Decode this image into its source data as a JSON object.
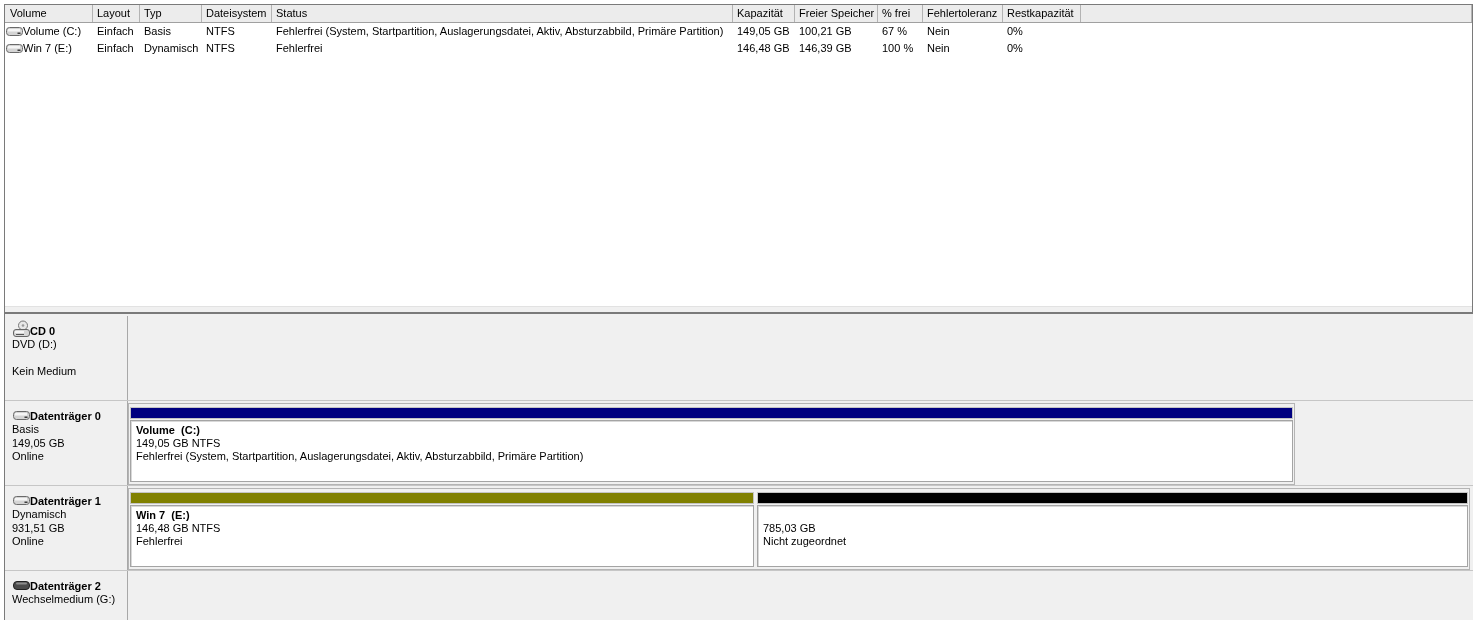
{
  "volume_table": {
    "columns": [
      "Volume",
      "Layout",
      "Typ",
      "Dateisystem",
      "Status",
      "Kapazität",
      "Freier Speicher",
      "% frei",
      "Fehlertoleranz",
      "Restkapazität"
    ],
    "rows": [
      [
        "Volume (C:)",
        "Einfach",
        "Basis",
        "NTFS",
        "Fehlerfrei (System, Startpartition, Auslagerungsdatei, Aktiv, Absturzabbild, Primäre Partition)",
        "149,05 GB",
        "100,21 GB",
        "67 %",
        "Nein",
        "0%"
      ],
      [
        "Win 7 (E:)",
        "Einfach",
        "Dynamisch",
        "NTFS",
        "Fehlerfrei",
        "146,48 GB",
        "146,39 GB",
        "100 %",
        "Nein",
        "0%"
      ]
    ]
  },
  "disks": [
    {
      "kind": "cd",
      "name": "CD 0",
      "type": "DVD (D:)",
      "status": "Kein Medium"
    },
    {
      "kind": "disk",
      "name": "Datenträger 0",
      "type": "Basis",
      "size": "149,05 GB",
      "status": "Online",
      "partitions": [
        {
          "kind": "volume",
          "color": "#000080",
          "title": "Volume  (C:)",
          "size": "149,05 GB NTFS",
          "status": "Fehlerfrei (System, Startpartition, Auslagerungsdatei, Aktiv, Absturzabbild, Primäre Partition)"
        }
      ]
    },
    {
      "kind": "disk",
      "name": "Datenträger 1",
      "type": "Dynamisch",
      "size": "931,51 GB",
      "status": "Online",
      "partitions": [
        {
          "kind": "volume",
          "color": "#808000",
          "title": "Win 7  (E:)",
          "size": "146,48 GB NTFS",
          "status": "Fehlerfrei"
        },
        {
          "kind": "unallocated",
          "color": "#000000",
          "size": "785,03 GB",
          "status": "Nicht zugeordnet"
        }
      ]
    },
    {
      "kind": "removable",
      "name": "Datenträger 2",
      "type": "Wechselmedium (G:)"
    }
  ]
}
